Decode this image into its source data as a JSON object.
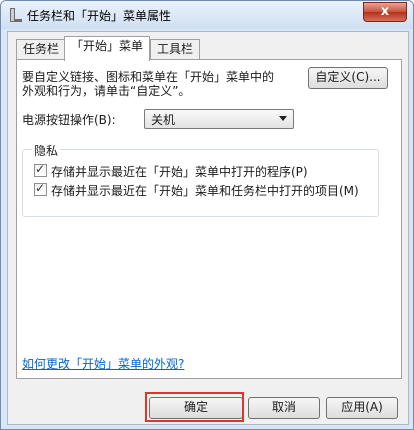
{
  "window": {
    "title": "任务栏和「开始」菜单属性",
    "close_label": "x"
  },
  "tabs": [
    {
      "label": "任务栏"
    },
    {
      "label": "「开始」菜单"
    },
    {
      "label": "工具栏"
    }
  ],
  "main": {
    "description_line1": "要自定义链接、图标和菜单在「开始」菜单中的",
    "description_line2": "外观和行为，请单击“自定义”。",
    "customize_button": "自定义(C)...",
    "power_label": "电源按钮操作(B):",
    "power_value": "关机",
    "privacy_title": "隐私",
    "privacy_options": [
      {
        "label": "存储并显示最近在「开始」菜单中打开的程序(P)",
        "checked": true
      },
      {
        "label": "存储并显示最近在「开始」菜单和任务栏中打开的项目(M)",
        "checked": true
      }
    ],
    "help_link": "如何更改「开始」菜单的外观?"
  },
  "footer": {
    "ok": "确定",
    "cancel": "取消",
    "apply": "应用(A)"
  }
}
